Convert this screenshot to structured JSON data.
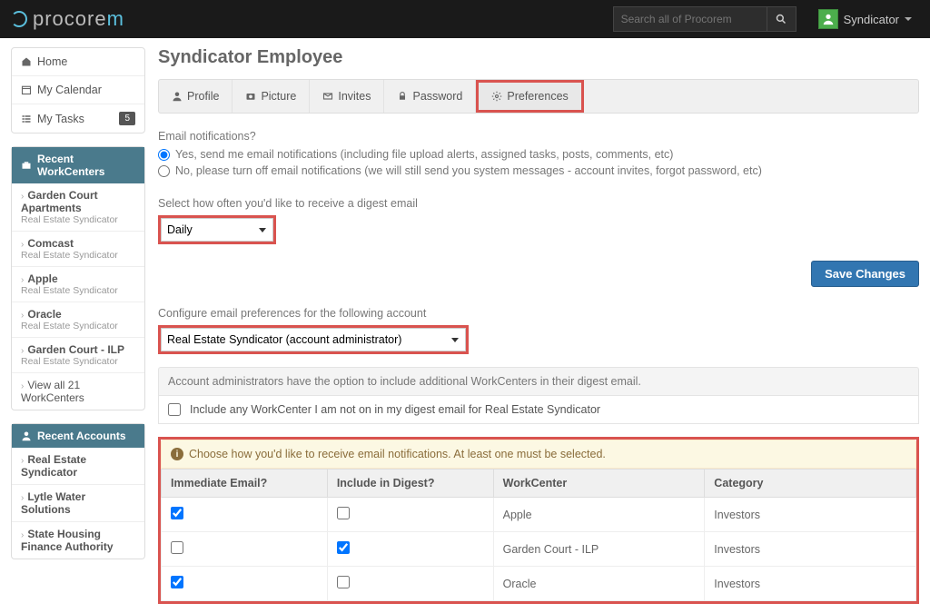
{
  "topbar": {
    "search_placeholder": "Search all of Procorem",
    "username": "Syndicator"
  },
  "sidebar": {
    "nav": {
      "home": "Home",
      "calendar": "My Calendar",
      "tasks": "My Tasks",
      "tasks_badge": "5"
    },
    "recent_wc_title": "Recent WorkCenters",
    "workcenters": [
      {
        "name": "Garden Court Apartments",
        "sub": "Real Estate Syndicator"
      },
      {
        "name": "Comcast",
        "sub": "Real Estate Syndicator"
      },
      {
        "name": "Apple",
        "sub": "Real Estate Syndicator"
      },
      {
        "name": "Oracle",
        "sub": "Real Estate Syndicator"
      },
      {
        "name": "Garden Court - ILP",
        "sub": "Real Estate Syndicator"
      }
    ],
    "view_all": "View all 21 WorkCenters",
    "recent_acc_title": "Recent Accounts",
    "accounts": [
      {
        "name": "Real Estate Syndicator"
      },
      {
        "name": "Lytle Water Solutions"
      },
      {
        "name": "State Housing Finance Authority"
      }
    ]
  },
  "page": {
    "title": "Syndicator Employee",
    "tabs": {
      "profile": "Profile",
      "picture": "Picture",
      "invites": "Invites",
      "password": "Password",
      "preferences": "Preferences"
    },
    "email_q": "Email notifications?",
    "radio_yes": "Yes, send me email notifications (including file upload alerts, assigned tasks, posts, comments, etc)",
    "radio_no": "No, please turn off email notifications (we will still send you system messages - account invites, forgot password, etc)",
    "digest_label": "Select how often you'd like to receive a digest email",
    "digest_value": "Daily",
    "save_btn": "Save Changes",
    "configure_label": "Configure email preferences for the following account",
    "account_value": "Real Estate Syndicator (account administrator)",
    "admin_note": "Account administrators have the option to include additional WorkCenters in their digest email.",
    "include_any": "Include any WorkCenter I am not on in my digest email for Real Estate Syndicator",
    "choose_note": "Choose how you'd like to receive email notifications. At least one must be selected.",
    "table": {
      "h1": "Immediate Email?",
      "h2": "Include in Digest?",
      "h3": "WorkCenter",
      "h4": "Category",
      "rows": [
        {
          "immediate": true,
          "digest": false,
          "wc": "Apple",
          "cat": "Investors"
        },
        {
          "immediate": false,
          "digest": true,
          "wc": "Garden Court - ILP",
          "cat": "Investors"
        },
        {
          "immediate": true,
          "digest": false,
          "wc": "Oracle",
          "cat": "Investors"
        }
      ]
    }
  }
}
